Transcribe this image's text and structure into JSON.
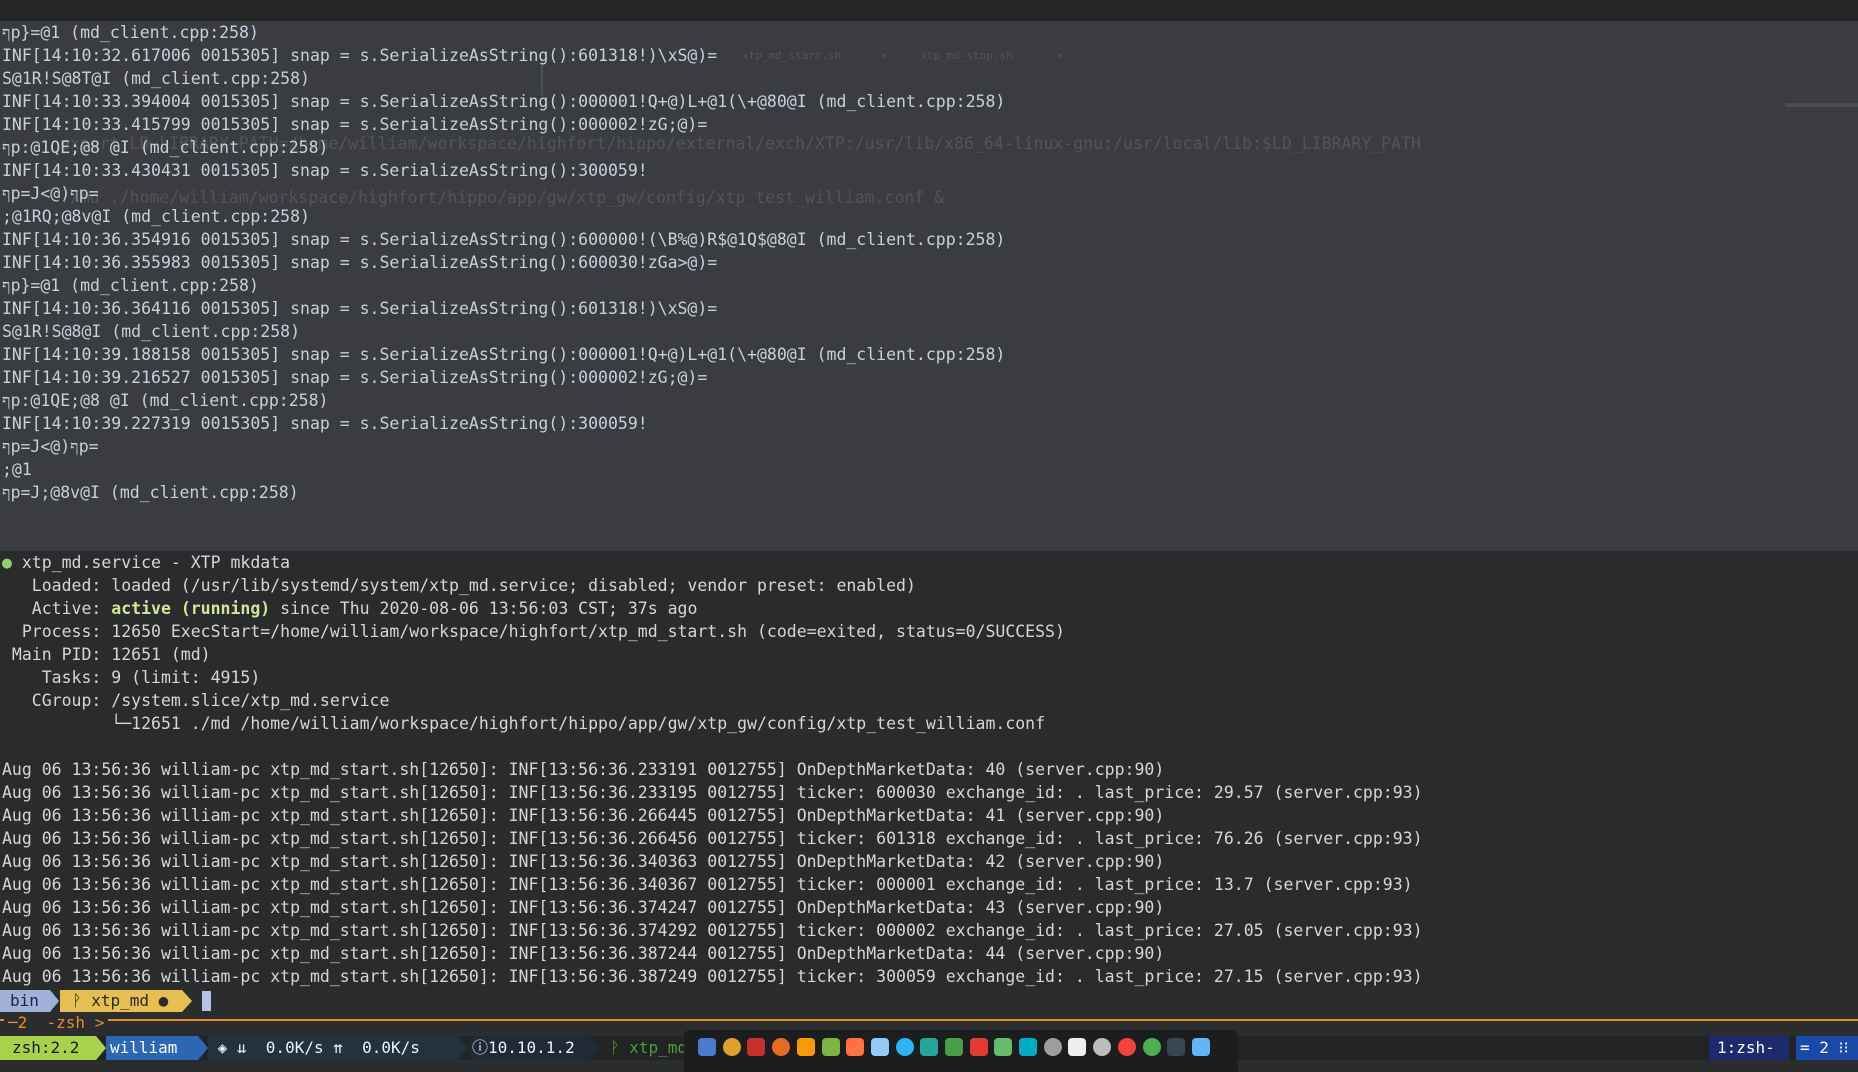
{
  "top_pane": {
    "lines": [
      "ףp}=@1 (md_client.cpp:258)",
      "INF[14:10:32.617006 0015305] snap = s.SerializeAsString():601318!)\\xS@)=",
      "S@1R!S@8T@I (md_client.cpp:258)",
      "INF[14:10:33.394004 0015305] snap = s.SerializeAsString():000001!Q+@)L+@1(\\+@80@I (md_client.cpp:258)",
      "INF[14:10:33.415799 0015305] snap = s.SerializeAsString():000002!zG;@)=",
      "ףp:@1QE;@8 @I (md_client.cpp:258)",
      "INF[14:10:33.430431 0015305] snap = s.SerializeAsString():300059!",
      "ףp=J<@)ףp=",
      ";@1RQ;@8v@I (md_client.cpp:258)",
      "INF[14:10:36.354916 0015305] snap = s.SerializeAsString():600000!(\\B%@)R$@1Q$@8@I (md_client.cpp:258)",
      "INF[14:10:36.355983 0015305] snap = s.SerializeAsString():600030!zGa>@)=",
      "ףp}=@1 (md_client.cpp:258)",
      "INF[14:10:36.364116 0015305] snap = s.SerializeAsString():601318!)\\xS@)=",
      "S@1R!S@8@I (md_client.cpp:258)",
      "INF[14:10:39.188158 0015305] snap = s.SerializeAsString():000001!Q+@)L+@1(\\+@80@I (md_client.cpp:258)",
      "INF[14:10:39.216527 0015305] snap = s.SerializeAsString():000002!zG;@)=",
      "ףp:@1QE;@8 @I (md_client.cpp:258)",
      "INF[14:10:39.227319 0015305] snap = s.SerializeAsString():300059!",
      "ףp=J<@)ףp=",
      ";@1",
      "ףp=J;@8v@I (md_client.cpp:258)"
    ],
    "ghost": {
      "tab1": "xtp_md_start.sh",
      "tab2": "xtp_md_stop.sh",
      "close": "×",
      "line1": "export LD_LIBRARY_PATH=/home/william/workspace/highfort/hippo/external/exch/XTP:/usr/lib/x86_64-linux-gnu:/usr/local/lib:$LD_LIBRARY_PATH",
      "line2": "./md ./home/william/workspace/highfort/hippo/app/gw/xtp_gw/config/xtp_test_william.conf &"
    }
  },
  "bottom_pane": {
    "service_header": {
      "dot": "●",
      "text": " xtp_md.service - XTP mkdata"
    },
    "loaded": "   Loaded: loaded (/usr/lib/systemd/system/xtp_md.service; disabled; vendor preset: enabled)",
    "active_prefix": "   Active: ",
    "active_state": "active (running)",
    "active_suffix": " since Thu 2020-08-06 13:56:03 CST; 37s ago",
    "process": "  Process: 12650 ExecStart=/home/william/workspace/highfort/xtp_md_start.sh (code=exited, status=0/SUCCESS)",
    "main_pid": " Main PID: 12651 (md)",
    "tasks": "    Tasks: 9 (limit: 4915)",
    "cgroup": "   CGroup: /system.slice/xtp_md.service",
    "cgroup_child": "           └─12651 ./md /home/william/workspace/highfort/hippo/app/gw/xtp_gw/config/xtp_test_william.conf",
    "journal": [
      "Aug 06 13:56:36 william-pc xtp_md_start.sh[12650]: INF[13:56:36.233191 0012755] OnDepthMarketData: 40 (server.cpp:90)",
      "Aug 06 13:56:36 william-pc xtp_md_start.sh[12650]: INF[13:56:36.233195 0012755] ticker: 600030 exchange_id: . last_price: 29.57 (server.cpp:93)",
      "Aug 06 13:56:36 william-pc xtp_md_start.sh[12650]: INF[13:56:36.266445 0012755] OnDepthMarketData: 41 (server.cpp:90)",
      "Aug 06 13:56:36 william-pc xtp_md_start.sh[12650]: INF[13:56:36.266456 0012755] ticker: 601318 exchange_id: . last_price: 76.26 (server.cpp:93)",
      "Aug 06 13:56:36 william-pc xtp_md_start.sh[12650]: INF[13:56:36.340363 0012755] OnDepthMarketData: 42 (server.cpp:90)",
      "Aug 06 13:56:36 william-pc xtp_md_start.sh[12650]: INF[13:56:36.340367 0012755] ticker: 000001 exchange_id: . last_price: 13.7 (server.cpp:93)",
      "Aug 06 13:56:36 william-pc xtp_md_start.sh[12650]: INF[13:56:36.374247 0012755] OnDepthMarketData: 43 (server.cpp:90)",
      "Aug 06 13:56:36 william-pc xtp_md_start.sh[12650]: INF[13:56:36.374292 0012755] ticker: 000002 exchange_id: . last_price: 27.05 (server.cpp:93)",
      "Aug 06 13:56:36 william-pc xtp_md_start.sh[12650]: INF[13:56:36.387244 0012755] OnDepthMarketData: 44 (server.cpp:90)",
      "Aug 06 13:56:36 william-pc xtp_md_start.sh[12650]: INF[13:56:36.387249 0012755] ticker: 300059 exchange_id: . last_price: 27.15 (server.cpp:93)"
    ]
  },
  "prompt": {
    "dir": "bin",
    "git": "ᚹ xtp_md ●"
  },
  "tmux": {
    "label": "─2  -zsh >"
  },
  "statusbar": {
    "session": "zsh:2.2",
    "user": "william",
    "net": " ◈ ⇊  0.0K/s ⇈  0.0K/s",
    "ip": "ⓘ10.10.1.2",
    "branch": "ᚹ xtp_md",
    "window1": "1:zsh-",
    "window2": "= 2 ⁝⁝"
  },
  "colors": {
    "accent_orange": "#e98a2b",
    "session_green": "#a7d24a",
    "user_blue": "#2d66b4",
    "prompt_blue": "#9fb1d9",
    "git_yellow": "#e6be52"
  },
  "dock": {
    "icons": [
      "anchor-icon",
      "chrome-icon",
      "redis-icon",
      "firefox-icon",
      "sublime-icon",
      "files-icon",
      "pdf-icon",
      "mail-icon",
      "browser-icon",
      "clion-icon",
      "pycharm-icon",
      "app-icon",
      "wrench-icon",
      "paint-icon",
      "circle-icon",
      "typora-icon",
      "wechat-icon",
      "colorpicker-icon",
      "terminal-icon",
      "monitor-icon",
      "display-icon"
    ]
  }
}
